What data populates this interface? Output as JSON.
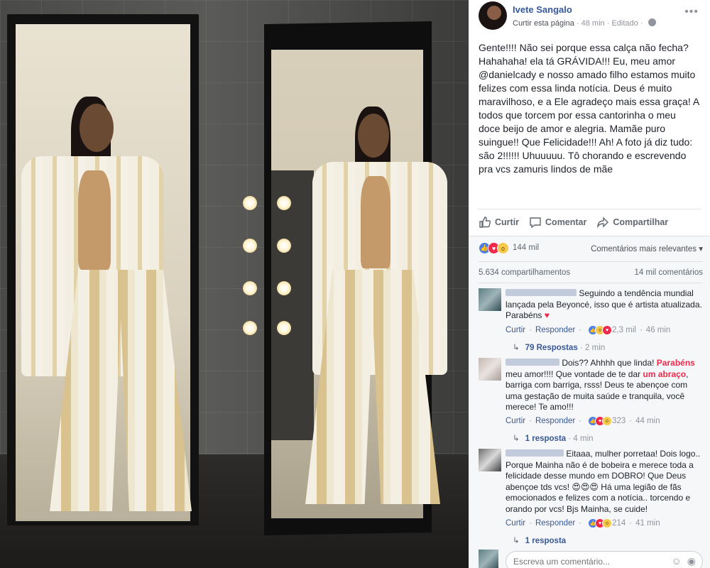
{
  "post": {
    "author": "Ivete Sangalo",
    "like_page": "Curtir esta página",
    "time": "48 min",
    "edited": "Editado",
    "text": "Gente!!!! Não sei porque essa calça não fecha? Hahahaha! ela tá GRÁVIDA!!! Eu, meu amor @danielcady e nosso amado filho estamos muito felizes com essa linda notícia. Deus é muito maravilhoso, e a Ele agradeço mais essa graça! A todos que torcem por essa cantorinha o meu doce beijo de amor e alegria. Mamãe puro suingue!! Que Felicidade!!! Ah! A foto já diz tudo: são 2!!!!!! Uhuuuuu. Tô chorando e escrevendo pra vcs zamuris lindos de mãe"
  },
  "actions": {
    "like": "Curtir",
    "comment": "Comentar",
    "share": "Compartilhar"
  },
  "reactions": {
    "count": "144 mil",
    "sort_label": "Comentários mais relevantes"
  },
  "counts": {
    "shares": "5.634 compartilhamentos",
    "comments": "14 mil comentários"
  },
  "comments": [
    {
      "text": "Seguindo a tendência mundial lançada pela Beyoncé, isso que é artista atualizada. Parabéns",
      "like": "Curtir",
      "reply": "Responder",
      "reaction_count": "2,3 mil",
      "time": "46 min",
      "replies": "79 Respostas",
      "replies_time": "2 min"
    },
    {
      "text_a": "Dois?? Ahhhh que linda!",
      "text_hl1": "Parabéns",
      "text_b": "meu amor!!!! Que vontade de te dar",
      "text_hl2": "um abraço",
      "text_c": ", barriga com barriga, rsss! Deus te abençoe com uma gestação de muita saúde e tranquila, você merece! Te amo!!!",
      "like": "Curtir",
      "reply": "Responder",
      "reaction_count": "323",
      "time": "44 min",
      "replies": "1 resposta",
      "replies_time": "4 min"
    },
    {
      "text_a": "Eitaaa, mulher porretaa! Dois logo.. Porque Mainha não é de bobeira e merece toda a felicidade desse mundo em DOBRO! Que Deus abençoe tds vcs!",
      "emoji": "😍😍😍",
      "text_b": "Há uma legião de fãs emocionados e felizes com a notícia.. torcendo e orando por vcs! Bjs Mainha, se cuide!",
      "like": "Curtir",
      "reply": "Responder",
      "reaction_count": "214",
      "time": "41 min",
      "replies": "1 resposta"
    }
  ],
  "composer": {
    "placeholder": "Escreva um comentário..."
  },
  "colors": {
    "link": "#365899",
    "like_blue": "#4a7ee8",
    "love_red": "#f0284a",
    "wow_yellow": "#f7c94b"
  }
}
